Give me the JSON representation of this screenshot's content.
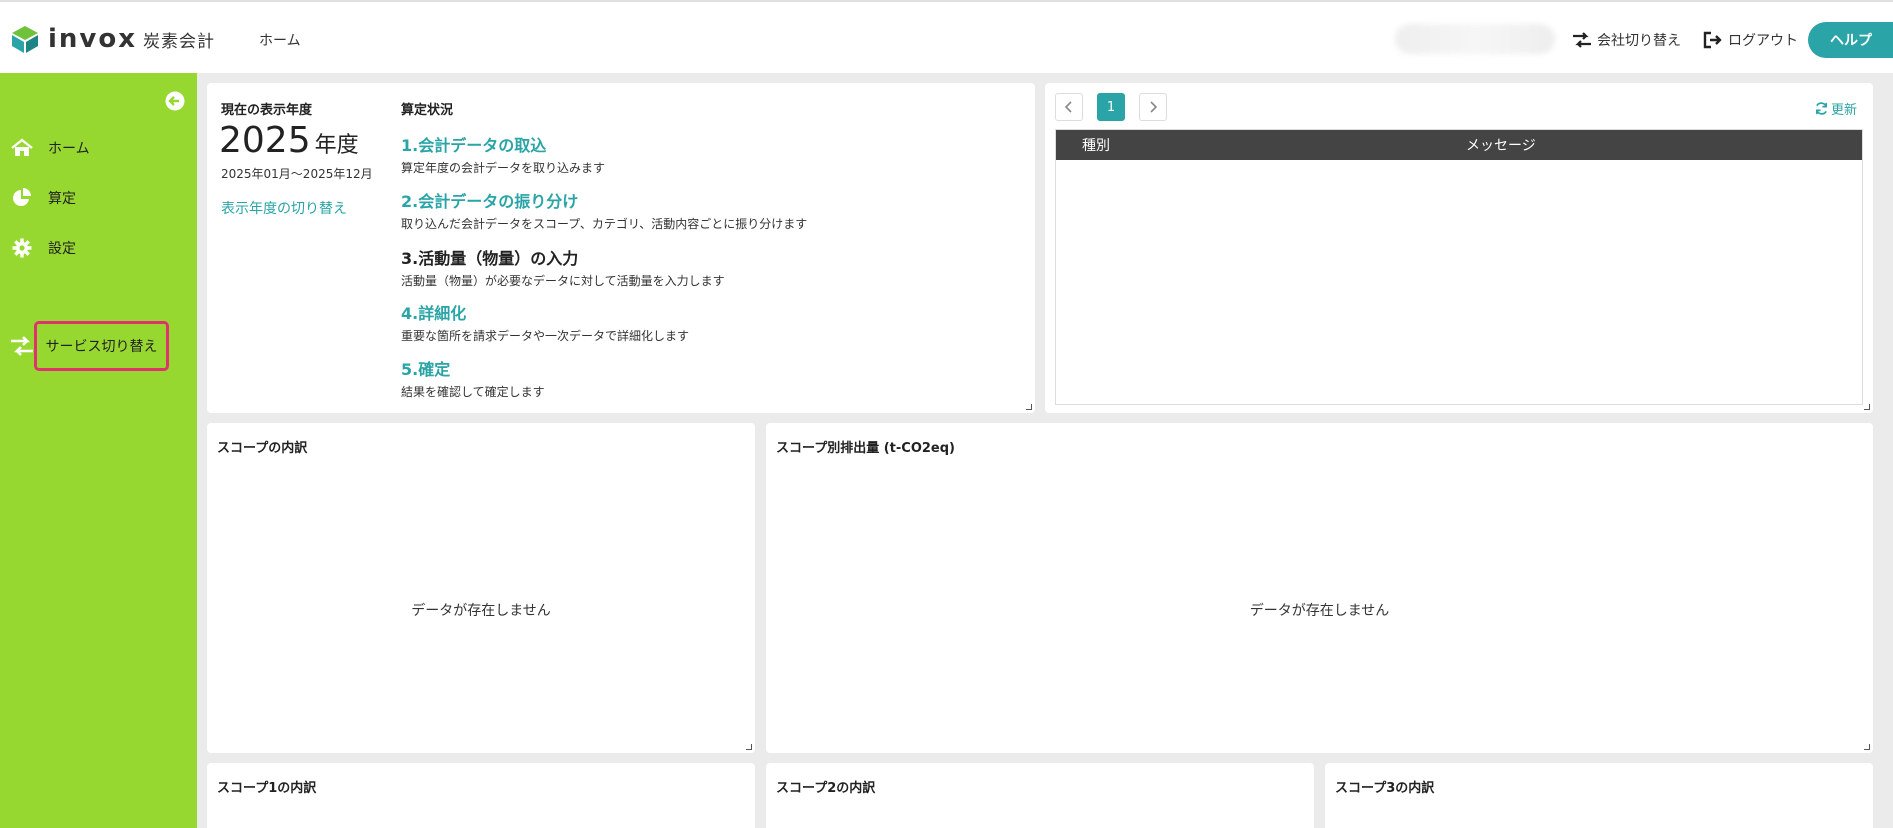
{
  "header": {
    "logo_text": "invox",
    "logo_sub": "炭素会計",
    "nav_home": "ホーム",
    "company_switch": "会社切り替え",
    "logout": "ログアウト",
    "help": "ヘルプ"
  },
  "sidebar": {
    "items": [
      {
        "label": "ホーム",
        "icon": "home-icon"
      },
      {
        "label": "算定",
        "icon": "pie-chart-icon"
      },
      {
        "label": "設定",
        "icon": "gear-icon"
      }
    ],
    "service_switch": "サービス切り替え"
  },
  "year_panel": {
    "label": "現在の表示年度",
    "year": "2025",
    "unit": "年度",
    "range": "2025年01月～2025年12月",
    "switch_link": "表示年度の切り替え"
  },
  "status_panel": {
    "label": "算定状況",
    "steps": [
      {
        "title": "1.会計データの取込",
        "desc": "算定年度の会計データを取り込みます"
      },
      {
        "title": "2.会計データの振り分け",
        "desc": "取り込んだ会計データをスコープ、カテゴリ、活動内容ごとに振り分けます"
      },
      {
        "title": "3.活動量（物量）の入力",
        "desc": "活動量（物量）が必要なデータに対して活動量を入力します"
      },
      {
        "title": "4.詳細化",
        "desc": "重要な箇所を請求データや一次データで詳細化します"
      },
      {
        "title": "5.確定",
        "desc": "結果を確認して確定します"
      }
    ]
  },
  "messages_panel": {
    "page": "1",
    "refresh": "更新",
    "columns": [
      "種別",
      "メッセージ"
    ]
  },
  "cards": {
    "scope_breakdown": {
      "title": "スコープの内訳",
      "empty": "データが存在しません"
    },
    "scope_emissions": {
      "title": "スコープ別排出量 (t-CO2eq)",
      "empty": "データが存在しません"
    },
    "scope1": {
      "title": "スコープ1の内訳"
    },
    "scope2": {
      "title": "スコープ2の内訳"
    },
    "scope3": {
      "title": "スコープ3の内訳"
    }
  },
  "colors": {
    "accent": "#2aa4a6",
    "sidebar": "#97d830",
    "highlight": "#e0336e"
  }
}
